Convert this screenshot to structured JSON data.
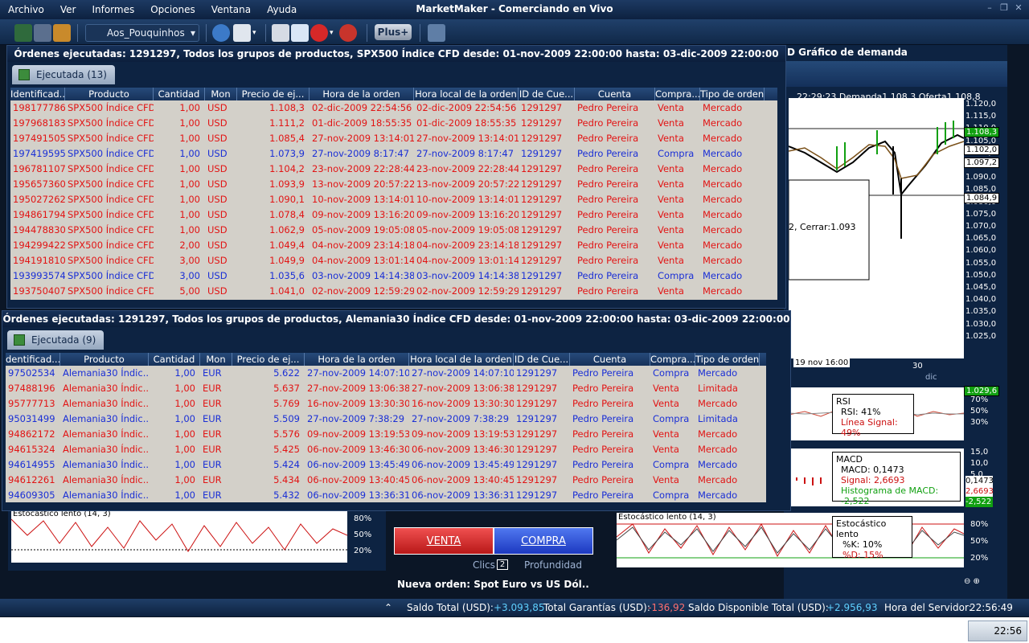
{
  "app": {
    "title": "MarketMaker - Comerciando en Vivo"
  },
  "menu": [
    "Archivo",
    "Ver",
    "Informes",
    "Opciones",
    "Ventana",
    "Ayuda"
  ],
  "toolbar": {
    "account": "Aos_Pouquinhos",
    "plus": "Plus+"
  },
  "spx": {
    "title": "Órdenes ejecutadas: 1291297, Todos los grupos de productos, SPX500 Índice CFD desde: 01-nov-2009 22:00:00 hasta: 03-dic-2009 22:00:00",
    "tab": "Ejecutada (13)",
    "headers": [
      "Identificad...",
      "Producto",
      "Cantidad",
      "Mon",
      "Precio de ej...",
      "Hora de la orden",
      "Hora local de la orden",
      "ID de Cue...",
      "Cuenta",
      "Compra...",
      "Tipo de orden"
    ],
    "rows": [
      [
        "198177786",
        "SPX500 Índice CFD",
        "1,00",
        "USD",
        "1.108,3",
        "02-dic-2009 22:54:56",
        "02-dic-2009 22:54:56",
        "1291297",
        "Pedro Pereira",
        "Venta",
        "Mercado",
        "red"
      ],
      [
        "197968183",
        "SPX500 Índice CFD",
        "1,00",
        "USD",
        "1.111,2",
        "01-dic-2009 18:55:35",
        "01-dic-2009 18:55:35",
        "1291297",
        "Pedro Pereira",
        "Venta",
        "Mercado",
        "red"
      ],
      [
        "197491505",
        "SPX500 Índice CFD",
        "1,00",
        "USD",
        "1.085,4",
        "27-nov-2009 13:14:01",
        "27-nov-2009 13:14:01",
        "1291297",
        "Pedro Pereira",
        "Venta",
        "Mercado",
        "red"
      ],
      [
        "197419595",
        "SPX500 Índice CFD",
        "1,00",
        "USD",
        "1.073,9",
        "27-nov-2009 8:17:47",
        "27-nov-2009 8:17:47",
        "1291297",
        "Pedro Pereira",
        "Compra",
        "Mercado",
        "blue"
      ],
      [
        "196781107",
        "SPX500 Índice CFD",
        "1,00",
        "USD",
        "1.104,2",
        "23-nov-2009 22:28:44",
        "23-nov-2009 22:28:44",
        "1291297",
        "Pedro Pereira",
        "Venta",
        "Mercado",
        "red"
      ],
      [
        "195657360",
        "SPX500 Índice CFD",
        "1,00",
        "USD",
        "1.093,9",
        "13-nov-2009 20:57:22",
        "13-nov-2009 20:57:22",
        "1291297",
        "Pedro Pereira",
        "Venta",
        "Mercado",
        "red"
      ],
      [
        "195027262",
        "SPX500 Índice CFD",
        "1,00",
        "USD",
        "1.090,1",
        "10-nov-2009 13:14:01",
        "10-nov-2009 13:14:01",
        "1291297",
        "Pedro Pereira",
        "Venta",
        "Mercado",
        "red"
      ],
      [
        "194861794",
        "SPX500 Índice CFD",
        "1,00",
        "USD",
        "1.078,4",
        "09-nov-2009 13:16:20",
        "09-nov-2009 13:16:20",
        "1291297",
        "Pedro Pereira",
        "Venta",
        "Mercado",
        "red"
      ],
      [
        "194478830",
        "SPX500 Índice CFD",
        "1,00",
        "USD",
        "1.062,9",
        "05-nov-2009 19:05:08",
        "05-nov-2009 19:05:08",
        "1291297",
        "Pedro Pereira",
        "Venta",
        "Mercado",
        "red"
      ],
      [
        "194299422",
        "SPX500 Índice CFD",
        "2,00",
        "USD",
        "1.049,4",
        "04-nov-2009 23:14:18",
        "04-nov-2009 23:14:18",
        "1291297",
        "Pedro Pereira",
        "Venta",
        "Mercado",
        "red"
      ],
      [
        "194191810",
        "SPX500 Índice CFD",
        "3,00",
        "USD",
        "1.049,9",
        "04-nov-2009 13:01:14",
        "04-nov-2009 13:01:14",
        "1291297",
        "Pedro Pereira",
        "Venta",
        "Mercado",
        "red"
      ],
      [
        "193993574",
        "SPX500 Índice CFD",
        "3,00",
        "USD",
        "1.035,6",
        "03-nov-2009 14:14:38",
        "03-nov-2009 14:14:38",
        "1291297",
        "Pedro Pereira",
        "Compra",
        "Mercado",
        "blue"
      ],
      [
        "193750407",
        "SPX500 Índice CFD",
        "5,00",
        "USD",
        "1.041,0",
        "02-nov-2009 12:59:29",
        "02-nov-2009 12:59:29",
        "1291297",
        "Pedro Pereira",
        "Venta",
        "Mercado",
        "red"
      ]
    ]
  },
  "ale": {
    "title": "Órdenes ejecutadas: 1291297, Todos los grupos de productos, Alemania30 Índice CFD desde: 01-nov-2009 22:00:00 hasta: 03-dic-2009 22:00:00",
    "tab": "Ejecutada (9)",
    "headers": [
      "dentificad...",
      "Producto",
      "Cantidad",
      "Mon",
      "Precio de ej...",
      "Hora de la orden",
      "Hora local de la orden",
      "ID de Cue...",
      "Cuenta",
      "Compra...",
      "Tipo de orden"
    ],
    "rows": [
      [
        "97502534",
        "Alemania30 Índic...",
        "1,00",
        "EUR",
        "5.622",
        "27-nov-2009 14:07:10",
        "27-nov-2009 14:07:10",
        "1291297",
        "Pedro Pereira",
        "Compra",
        "Mercado",
        "blue"
      ],
      [
        "97488196",
        "Alemania30 Índic...",
        "1,00",
        "EUR",
        "5.637",
        "27-nov-2009 13:06:38",
        "27-nov-2009 13:06:38",
        "1291297",
        "Pedro Pereira",
        "Venta",
        "Limitada",
        "red"
      ],
      [
        "95777713",
        "Alemania30 Índic...",
        "1,00",
        "EUR",
        "5.769",
        "16-nov-2009 13:30:30",
        "16-nov-2009 13:30:30",
        "1291297",
        "Pedro Pereira",
        "Venta",
        "Mercado",
        "red"
      ],
      [
        "95031499",
        "Alemania30 Índic...",
        "1,00",
        "EUR",
        "5.509",
        "27-nov-2009 7:38:29",
        "27-nov-2009 7:38:29",
        "1291297",
        "Pedro Pereira",
        "Compra",
        "Limitada",
        "blue"
      ],
      [
        "94862172",
        "Alemania30 Índic...",
        "1,00",
        "EUR",
        "5.576",
        "09-nov-2009 13:19:53",
        "09-nov-2009 13:19:53",
        "1291297",
        "Pedro Pereira",
        "Venta",
        "Mercado",
        "red"
      ],
      [
        "94615324",
        "Alemania30 Índic...",
        "1,00",
        "EUR",
        "5.425",
        "06-nov-2009 13:46:30",
        "06-nov-2009 13:46:30",
        "1291297",
        "Pedro Pereira",
        "Venta",
        "Mercado",
        "red"
      ],
      [
        "94614955",
        "Alemania30 Índic...",
        "1,00",
        "EUR",
        "5.424",
        "06-nov-2009 13:45:49",
        "06-nov-2009 13:45:49",
        "1291297",
        "Pedro Pereira",
        "Compra",
        "Mercado",
        "blue"
      ],
      [
        "94612261",
        "Alemania30 Índic...",
        "1,00",
        "EUR",
        "5.434",
        "06-nov-2009 13:40:45",
        "06-nov-2009 13:40:45",
        "1291297",
        "Pedro Pereira",
        "Venta",
        "Mercado",
        "red"
      ],
      [
        "94609305",
        "Alemania30 Índic...",
        "1,00",
        "EUR",
        "5.432",
        "06-nov-2009 13:36:31",
        "06-nov-2009 13:36:31",
        "1291297",
        "Pedro Pereira",
        "Compra",
        "Mercado",
        "blue"
      ]
    ]
  },
  "chart": {
    "title": "D Gráfico de demanda",
    "time": "22:29:23",
    "demand": "Demanda1.108,3",
    "offer": "Oferta1.108,8",
    "prices": [
      "1.120,0",
      "1.115,0",
      "1.110,0",
      "1.105,0",
      "1.100,0",
      "1.095,0",
      "1.090,0",
      "1.085,0",
      "1.080,0",
      "1.075,0",
      "1.070,0",
      "1.065,0",
      "1.060,0",
      "1.055,0",
      "1.050,0",
      "1.045,0",
      "1.040,0",
      "1.035,0",
      "1.030,0",
      "1.025,0"
    ],
    "tags": [
      "1.108,3",
      "1.102,0",
      "1.097,2",
      "1.084,9",
      "1.029,6"
    ],
    "popup": "2, Cerrar:1.093",
    "xdate": "19 nov 16:00",
    "x30": "30",
    "xdic": "dic",
    "rsi": {
      "title": "RSI",
      "value": "RSI: 41%",
      "signal": "Línea Signal: 49%",
      "levels": [
        "70%",
        "50%",
        "30%"
      ]
    },
    "macd": {
      "title": "MACD",
      "value": "MACD: 0,1473",
      "signal": "Signal: 2,6693",
      "hist": "Histograma de MACD: -2,522",
      "levels": [
        "15,0",
        "10,0",
        "5,0"
      ],
      "tags": [
        "0,1473",
        "2,6693",
        "-2,522"
      ]
    },
    "sto": {
      "header": "Estocástico lento (14, 3)",
      "title": "Estocástico lento",
      "k": "%K: 10%",
      "d": "%D: 15%",
      "levels": [
        "80%",
        "50%",
        "20%"
      ]
    }
  },
  "lefttrad": {
    "sto": "Estocástico lento (14, 3)",
    "levels": [
      "80%",
      "50%",
      "20%"
    ]
  },
  "trade": {
    "sell": "VENTA",
    "buy": "COMPRA",
    "clicks": "Clics",
    "clicks_n": "2",
    "depth": "Profundidad",
    "new_order": "Nueva orden: Spot Euro vs US Dól..."
  },
  "status": {
    "balance_label": "Saldo Total (USD):",
    "balance": "+3.093,85",
    "guarantee_label": "Total Garantías (USD):",
    "guarantee": "-136,92",
    "available_label": "Saldo Disponible Total (USD):",
    "available": "+2.956,93",
    "server_label": "Hora del Servidor:",
    "server": "22:56:49"
  },
  "clock": "22:56",
  "colors": {
    "red": "#e21414",
    "blue": "#1a2fd6"
  }
}
